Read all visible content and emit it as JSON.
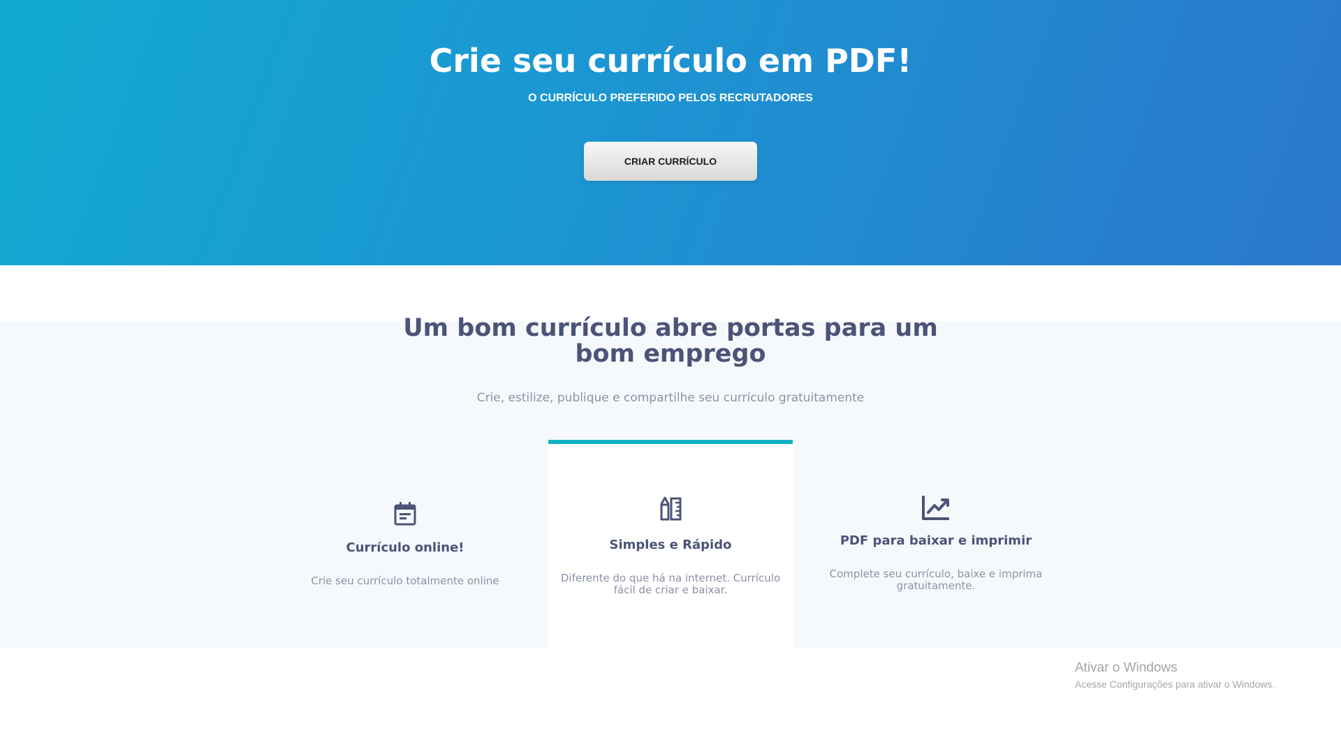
{
  "hero": {
    "title": "Crie seu currículo em PDF!",
    "subtitle": "O CURRÍCULO PREFERIDO PELOS RECRUTADORES",
    "button_label": "CRIAR CURRÍCULO"
  },
  "features": {
    "title": "Um bom currículo abre portas para um bom emprego",
    "subtitle": "Crie, estilize, publique e compartilhe seu currículo gratuitamente",
    "cards": [
      {
        "icon": "calendar-icon",
        "title": "Currículo online!",
        "text": "Crie seu currículo totalmente online"
      },
      {
        "icon": "pencil-ruler-icon",
        "title": "Simples e Rápido",
        "text": "Diferente do que há na internet. Currículo fácil de criar e baixar."
      },
      {
        "icon": "line-chart-icon",
        "title": "PDF para baixar e imprimir",
        "text": "Complete seu currículo, baixe e imprima gratuitamente."
      }
    ]
  },
  "windows_watermark": {
    "title": "Ativar o Windows",
    "subtitle": "Acesse Configurações para ativar o Windows."
  },
  "colors": {
    "hero_gradient_start": "#12aad0",
    "hero_gradient_end": "#2b77cc",
    "accent": "#13b1c4",
    "heading": "#4b5377",
    "muted": "#8b91a6",
    "section_bg": "#f6f9fc"
  }
}
